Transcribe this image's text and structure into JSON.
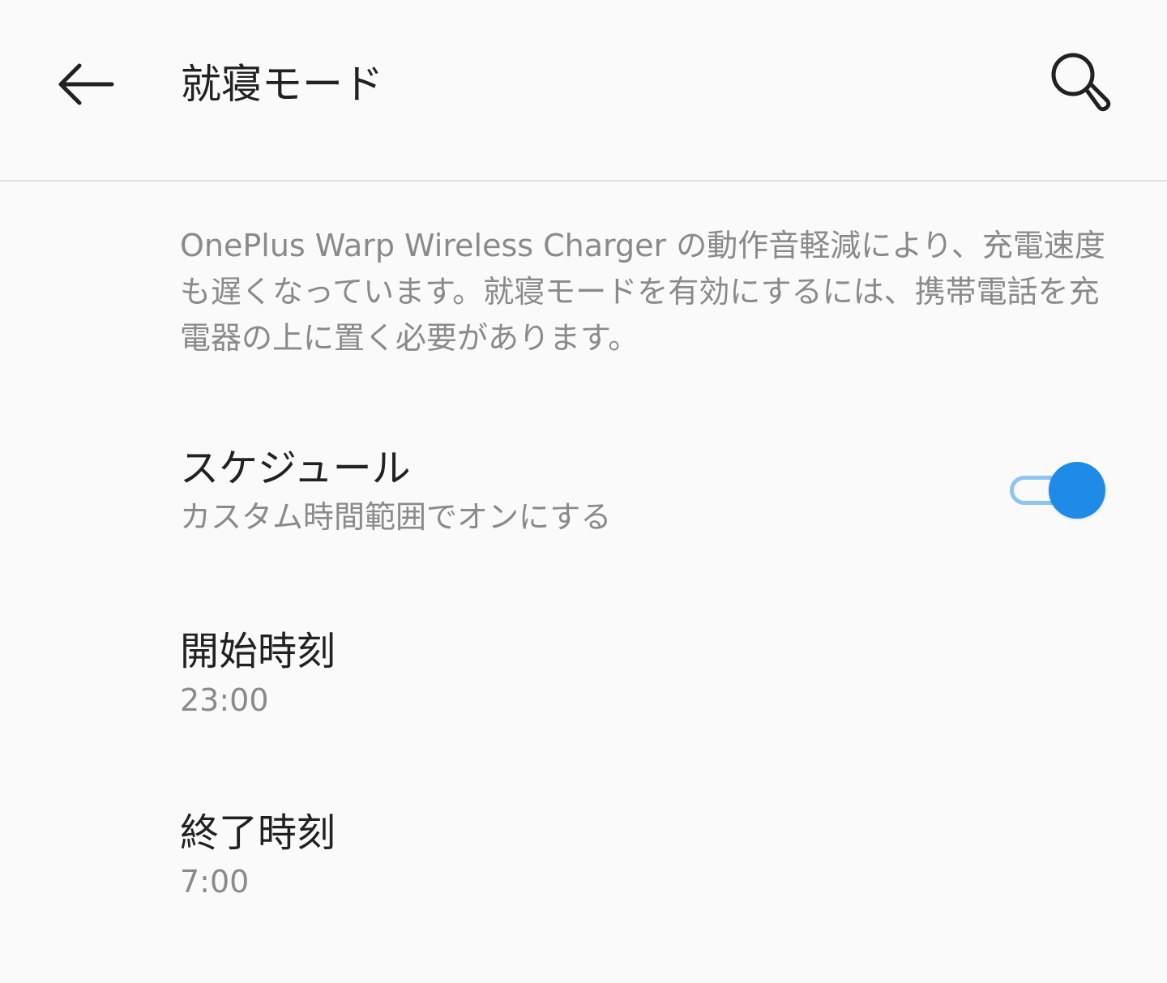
{
  "header": {
    "title": "就寝モード",
    "back_icon": "arrow-left-icon",
    "search_icon": "search-icon"
  },
  "description": "OnePlus Warp Wireless Charger の動作音軽減により、充電速度も遅くなっています。就寝モードを有効にするには、携帯電話を充電器の上に置く必要があります。",
  "schedule": {
    "title": "スケジュール",
    "subtitle": "カスタム時間範囲でオンにする",
    "enabled": true
  },
  "start_time": {
    "title": "開始時刻",
    "value": "23:00"
  },
  "end_time": {
    "title": "終了時刻",
    "value": "7:00"
  },
  "colors": {
    "accent": "#1e8ce6",
    "accent_track": "#8cc4f2",
    "background": "#fafafa",
    "primary_text": "#212121",
    "secondary_text": "#8a8a8a",
    "divider": "#e2e2e2"
  }
}
